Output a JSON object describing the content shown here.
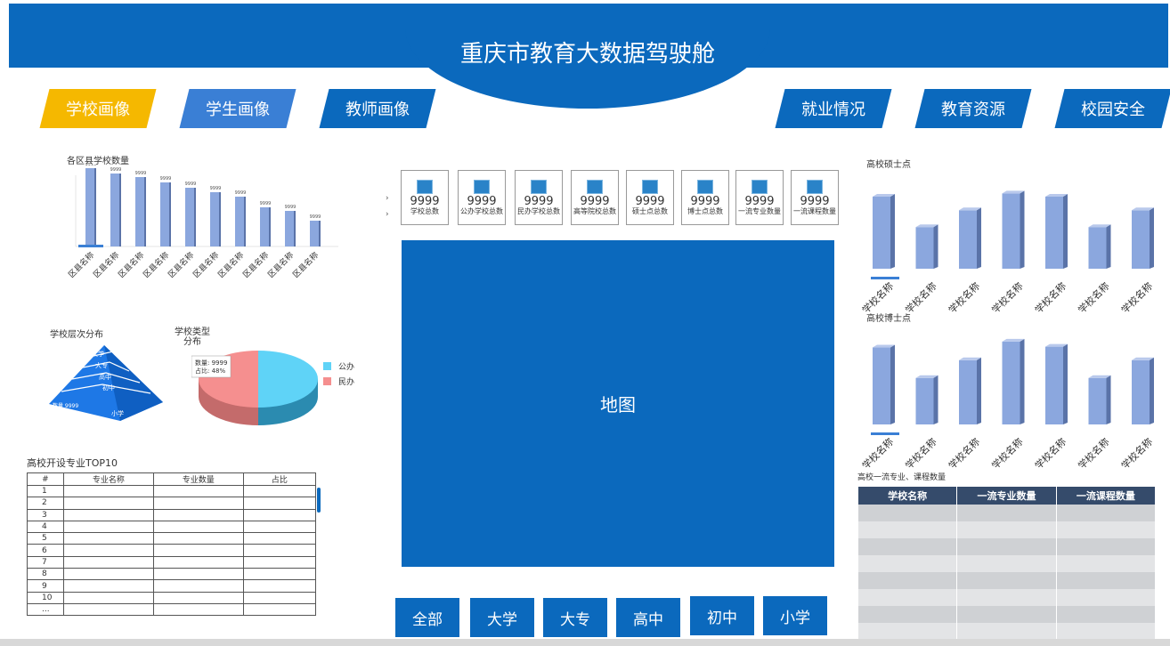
{
  "header": {
    "title": "重庆市教育大数据驾驶舱"
  },
  "nav": {
    "left": [
      "学校画像",
      "学生画像",
      "教师画像"
    ],
    "right": [
      "就业情况",
      "教育资源",
      "校园安全"
    ],
    "active_color": "#f5b800",
    "secondary_color": "#3a7fd5",
    "default_color": "#0b69bd"
  },
  "district_chart": {
    "title": "各区县学校数量",
    "chart_data": {
      "type": "bar",
      "categories": [
        "区县名称",
        "区县名称",
        "区县名称",
        "区县名称",
        "区县名称",
        "区县名称",
        "区县名称",
        "区县名称",
        "区县名称",
        "区县名称"
      ],
      "values": [
        9999,
        9999,
        9999,
        9999,
        9999,
        9999,
        9999,
        9999,
        9999,
        9999
      ],
      "data_labels": [
        "9999",
        "9999",
        "9999",
        "9999",
        "9999",
        "9999",
        "9999",
        "9999",
        "9999",
        "9999"
      ]
    }
  },
  "level_chart": {
    "title": "学校层次分布",
    "layers": [
      "大学",
      "大专",
      "高中",
      "初中",
      "小学"
    ],
    "tooltip": "数量 9999"
  },
  "type_chart": {
    "title_line1": "学校类型",
    "title_line2": "分布",
    "tooltip_line1": "数量: 9999",
    "tooltip_line2": "占比: 48%",
    "chart_data": {
      "type": "pie",
      "series": [
        {
          "name": "公办",
          "value": 52,
          "color": "#5fd3f7"
        },
        {
          "name": "民办",
          "value": 48,
          "color": "#f58f8f"
        }
      ]
    }
  },
  "top10": {
    "title": "高校开设专业TOP10",
    "columns": [
      "#",
      "专业名称",
      "专业数量",
      "占比"
    ],
    "rows": [
      "1",
      "2",
      "3",
      "4",
      "5",
      "6",
      "7",
      "8",
      "9",
      "10",
      "..."
    ]
  },
  "stats": [
    {
      "value": "9999",
      "label": "学校总数"
    },
    {
      "value": "9999",
      "label": "公办学校总数"
    },
    {
      "value": "9999",
      "label": "民办学校总数"
    },
    {
      "value": "9999",
      "label": "高等院校总数"
    },
    {
      "value": "9999",
      "label": "硕士点总数"
    },
    {
      "value": "9999",
      "label": "博士点总数"
    },
    {
      "value": "9999",
      "label": "一流专业数量"
    },
    {
      "value": "9999",
      "label": "一流课程数量"
    }
  ],
  "map": {
    "label": "地图"
  },
  "filters": [
    "全部",
    "大学",
    "大专",
    "高中",
    "初中",
    "小学"
  ],
  "master_chart": {
    "title": "高校硕士点",
    "chart_data": {
      "type": "bar",
      "categories": [
        "学校名称",
        "学校名称",
        "学校名称",
        "学校名称",
        "学校名称",
        "学校名称",
        "学校名称"
      ],
      "values": [
        90,
        52,
        73,
        94,
        90,
        52,
        73
      ]
    }
  },
  "doctor_chart": {
    "title": "高校博士点",
    "chart_data": {
      "type": "bar",
      "categories": [
        "学校名称",
        "学校名称",
        "学校名称",
        "学校名称",
        "学校名称",
        "学校名称",
        "学校名称"
      ],
      "values": [
        91,
        55,
        76,
        98,
        92,
        55,
        76
      ]
    }
  },
  "first_class": {
    "title": "高校一流专业、课程数量",
    "columns": [
      "学校名称",
      "一流专业数量",
      "一流课程数量"
    ],
    "row_count": 8
  },
  "colors": {
    "bar": "#8ba7de",
    "bar_side": "#5a73a8",
    "bar_top": "#b9c9ec",
    "map": "#0b69bd"
  }
}
